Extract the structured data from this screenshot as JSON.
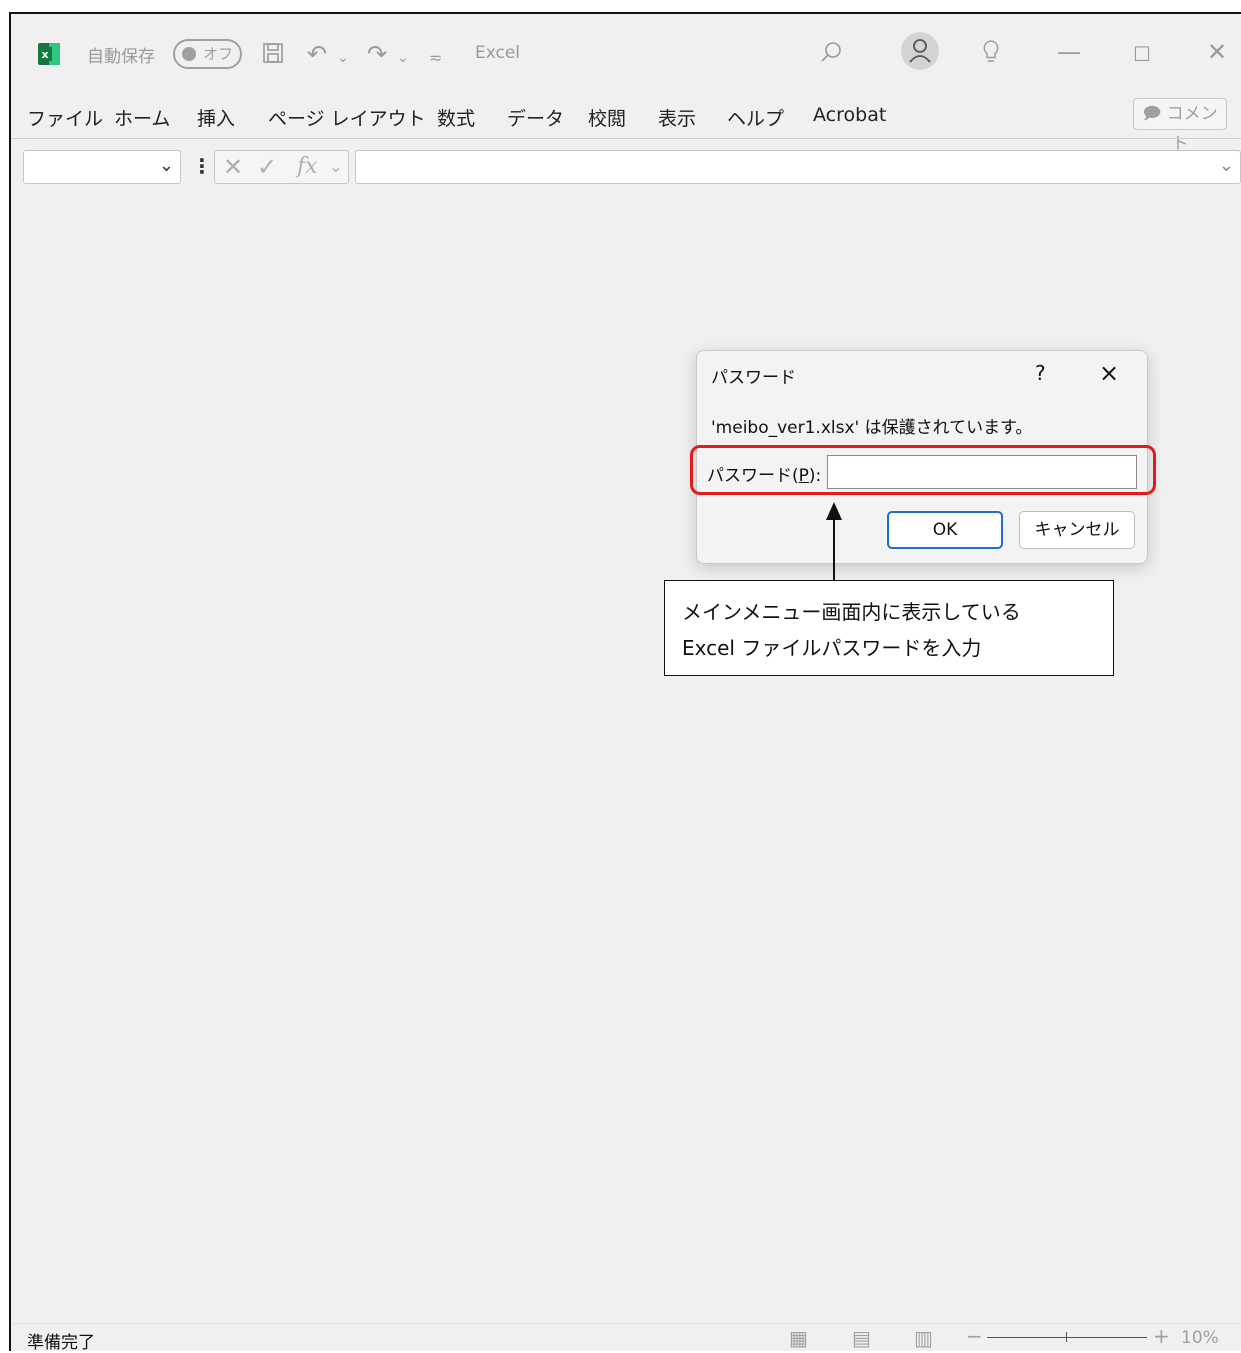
{
  "titlebar": {
    "app_name": "Excel",
    "autosave_label": "自動保存",
    "autosave_state": "オフ"
  },
  "menu": {
    "items": [
      "ファイル",
      "ホーム",
      "挿入",
      "ページ レイアウト",
      "数式",
      "データ",
      "校閲",
      "表示",
      "ヘルプ",
      "Acrobat"
    ],
    "comment_label": "コメント"
  },
  "formula_bar": {
    "name_box_value": "",
    "fx_label": "fx",
    "formula_value": ""
  },
  "dialog": {
    "title": "パスワード",
    "help": "?",
    "close": "×",
    "message": "'meibo_ver1.xlsx' は保護されています。",
    "password_label_prefix": "パスワード(",
    "password_label_key": "P",
    "password_label_suffix": "):",
    "password_value": "",
    "ok_label": "OK",
    "cancel_label": "キャンセル"
  },
  "annotation": {
    "line1": "メインメニュー画面内に表示している",
    "line2": "Excel ファイルパスワードを入力",
    "highlight_color": "#e31b1b"
  },
  "status": {
    "text": "準備完了",
    "zoom_minus": "−",
    "zoom_plus": "+",
    "zoom_level": "10%"
  },
  "colors": {
    "excel_green": "#1d6f42",
    "accent_blue": "#1f6fd0"
  }
}
